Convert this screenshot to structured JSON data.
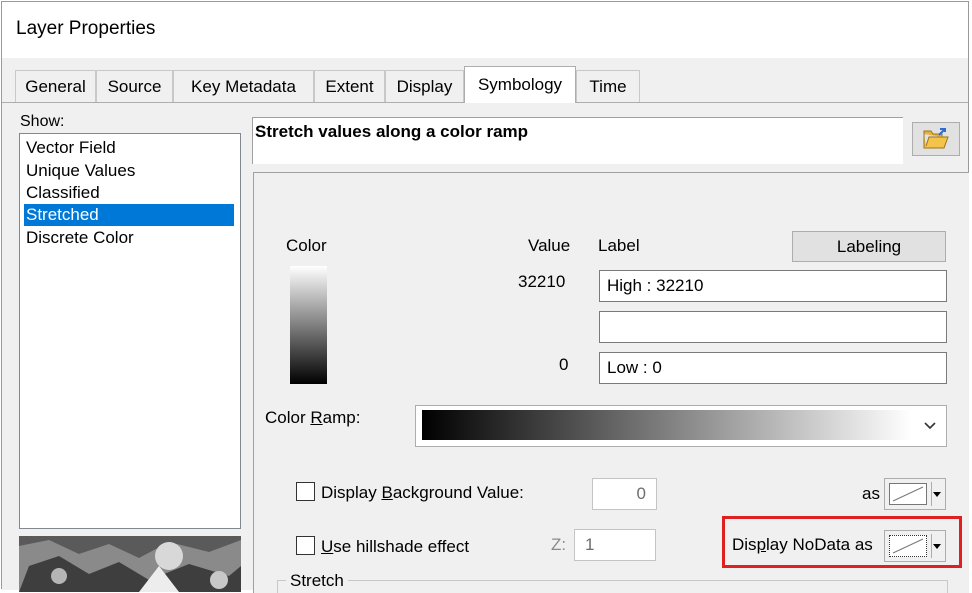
{
  "window": {
    "title": "Layer Properties"
  },
  "tabs": [
    {
      "label": "General"
    },
    {
      "label": "Source"
    },
    {
      "label": "Key Metadata"
    },
    {
      "label": "Extent"
    },
    {
      "label": "Display"
    },
    {
      "label": "Symbology",
      "active": true
    },
    {
      "label": "Time"
    }
  ],
  "show": {
    "label": "Show:",
    "items": [
      "Vector Field",
      "Unique Values",
      "Classified",
      "Stretched",
      "Discrete Color"
    ],
    "selected": "Stretched"
  },
  "renderer": {
    "description": "Stretch values along a color ramp"
  },
  "legend": {
    "color_header": "Color",
    "value_header": "Value",
    "label_header": "Label",
    "labeling_button": "Labeling",
    "high_value": "32210",
    "low_value": "0",
    "high_label": "High : 32210",
    "mid_label": "",
    "low_label": "Low : 0"
  },
  "color_ramp": {
    "label": "Color Ramp:",
    "start_color": "#000000",
    "end_color": "#ffffff"
  },
  "background": {
    "label": "Display Background Value:",
    "checked": false,
    "value": "0",
    "as_label": "as"
  },
  "hillshade": {
    "label": "Use hillshade effect",
    "checked": false,
    "z_label": "Z:",
    "z_value": "1"
  },
  "nodata": {
    "label": "Display NoData as"
  },
  "stretch": {
    "label": "Stretch"
  },
  "colors": {
    "selection": "#0078d7",
    "highlight": "#e02020"
  },
  "icons": {
    "open_folder": "open-folder-icon",
    "dropdown": "chevron-down-icon"
  }
}
